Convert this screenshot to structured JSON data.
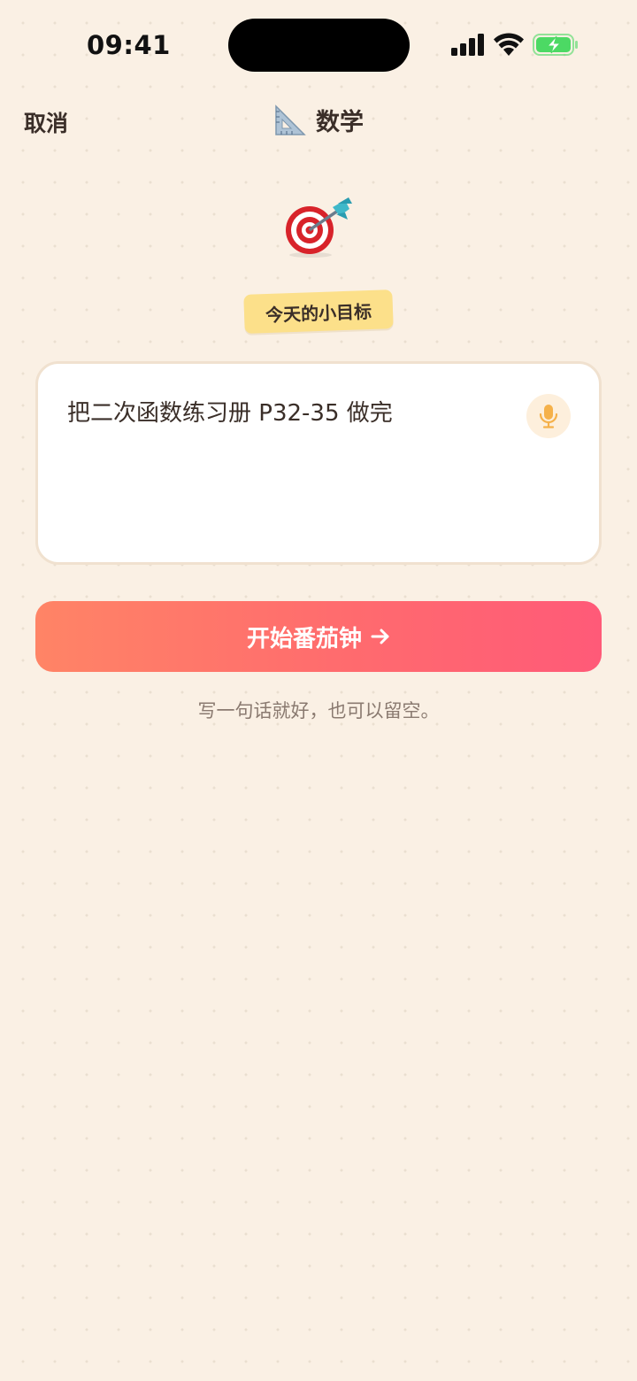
{
  "status_bar": {
    "time": "09:41",
    "signal_icon": "cellular-signal-icon",
    "wifi_icon": "wifi-icon",
    "battery_icon": "battery-charging-icon",
    "battery_color": "#4CD964"
  },
  "nav": {
    "cancel_label": "取消",
    "title_icon": "triangular-ruler-icon",
    "title": "数学"
  },
  "hero": {
    "icon": "direct-hit-target-icon",
    "badge_label": "今天的小目标",
    "badge_color": "#FCE08A"
  },
  "goal_input": {
    "value": "把二次函数练习册 P32-35 做完",
    "mic_icon": "microphone-icon",
    "mic_color": "#F5B14A"
  },
  "start_button": {
    "label": "开始番茄钟",
    "icon": "arrow-right-icon",
    "gradient": [
      "#FF8466",
      "#FF5A78"
    ]
  },
  "hint": "写一句话就好，也可以留空。",
  "colors": {
    "background": "#FAF0E4",
    "text": "#3A2E28",
    "muted_text": "#8A7A70"
  }
}
